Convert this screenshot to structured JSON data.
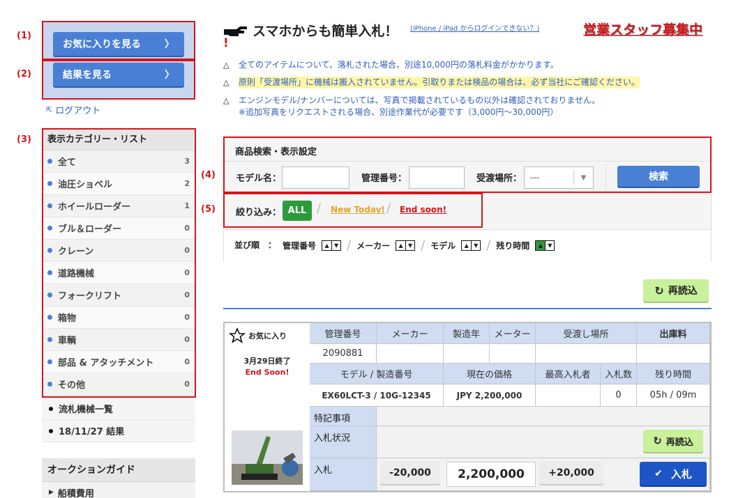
{
  "annotations": {
    "l1": "(1)",
    "l2": "(2)",
    "l3": "(3)",
    "l4": "(4)",
    "l5": "(5)"
  },
  "sidebar": {
    "favorites_button": "お気に入りを見る",
    "results_button": "結果を見る",
    "chevron": "〉",
    "logout": "ログアウト",
    "category_title": "表示カテゴリー・リスト",
    "categories": [
      {
        "label": "全て",
        "count": "3"
      },
      {
        "label": "油圧ショベル",
        "count": "2"
      },
      {
        "label": "ホイールローダー",
        "count": "1"
      },
      {
        "label": "ブル＆ローダー",
        "count": "0"
      },
      {
        "label": "クレーン",
        "count": "0"
      },
      {
        "label": "道路機械",
        "count": "0"
      },
      {
        "label": "フォークリフト",
        "count": "0"
      },
      {
        "label": "箱物",
        "count": "0"
      },
      {
        "label": "車輌",
        "count": "0"
      },
      {
        "label": "部品 & アタッチメント",
        "count": "0"
      },
      {
        "label": "その他",
        "count": "0"
      }
    ],
    "extra": [
      "流札機械一覧",
      "18/11/27 結果"
    ],
    "guide_title": "オークションガイド",
    "guide_items": [
      "船積費用"
    ]
  },
  "header": {
    "headline": "スマホからも簡単入札！",
    "login_help": "(iPhone / iPad からログインできない？)",
    "recruit": "営業スタッフ募集中",
    "recruit_tail": "!"
  },
  "notices": [
    "全てのアイテムについて、落札された場合、別途10,000円の落札料金がかかります。",
    "原則「受渡場所」に機械は搬入されていません。引取りまたは検品の場合は、必ず当社にご確認ください。",
    "エンジンモデル/ナンバーについては、写真で掲載されているもの以外は確認されておりません。",
    "※追加写真をリクエストされる場合、別途作業代が必要です（3,000円〜30,000円）"
  ],
  "search": {
    "title": "商品検索・表示設定",
    "model_label": "モデル名：",
    "model_value": "",
    "mgmt_label": "管理番号：",
    "mgmt_value": "",
    "place_label": "受渡場所：",
    "place_selected": "---",
    "search_button": "検索",
    "filter_label": "絞り込み：",
    "filter_all": "ALL",
    "filter_new": "New Today!",
    "filter_end": "End soon!",
    "sort_label": "並び順　：",
    "sort_items": [
      "管理番号",
      "メーカー",
      "モデル",
      "残り時間"
    ]
  },
  "reload_label": "再読込",
  "item": {
    "favorite_label": "お気に入り",
    "end_date": "3月29日終了",
    "end_soon": "End Soon!",
    "headers1": [
      "管理番号",
      "メーカー",
      "製造年",
      "メーター",
      "受渡し場所",
      "出庫料"
    ],
    "values1": [
      "2090881",
      "",
      "",
      "",
      "",
      ""
    ],
    "headers2": [
      "モデル / 製造番号",
      "現在の価格",
      "最高入札者",
      "入札数",
      "残り時間"
    ],
    "values2": [
      "EX60LCT-3 / 10G-12345",
      "JPY 2,200,000",
      "",
      "0",
      "05h / 09m"
    ],
    "note_label": "特記事項",
    "status_label": "入札状況",
    "bid_label": "入札",
    "minus": "-20,000",
    "bid_value": "2,200,000",
    "plus": "+20,000",
    "bid_button": "入札",
    "reload": "再読込"
  },
  "colors": {
    "accent_blue": "#4a7fd6",
    "annotation_red": "#d4141b",
    "reload_green": "#c9f09a",
    "header_blue": "#cfdcf2"
  }
}
